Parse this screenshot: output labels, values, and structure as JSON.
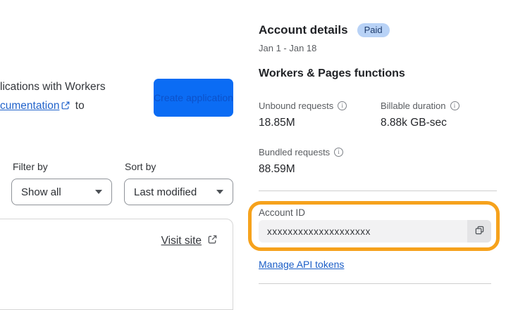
{
  "left_panel": {
    "intro": {
      "line1_text": "lications with Workers",
      "link_text": "cumentation",
      "after_link_text": " to"
    },
    "create_button_label": "Create application",
    "filter": {
      "label": "Filter by",
      "value": "Show all"
    },
    "sort": {
      "label": "Sort by",
      "value": "Last modified"
    },
    "visit_site_label": "Visit site"
  },
  "account_panel": {
    "title": "Account details",
    "plan_badge": "Paid",
    "date_range": "Jan 1 - Jan 18",
    "section_title": "Workers & Pages functions",
    "stats": [
      {
        "label": "Unbound requests",
        "value": "18.85M"
      },
      {
        "label": "Billable duration",
        "value": "8.88k GB-sec"
      },
      {
        "label": "Bundled requests",
        "value": "88.59M"
      }
    ],
    "account_id": {
      "label": "Account ID",
      "value": "xxxxxxxxxxxxxxxxxxxx"
    },
    "manage_link_label": "Manage API tokens"
  },
  "icons": {
    "info_glyph": "i"
  },
  "colors": {
    "accent_blue": "#0b6cf4",
    "link_blue": "#2163cb",
    "badge_bg": "#b8d2f6",
    "badge_text": "#1f3c6d",
    "highlight_orange": "#f6a21c"
  }
}
